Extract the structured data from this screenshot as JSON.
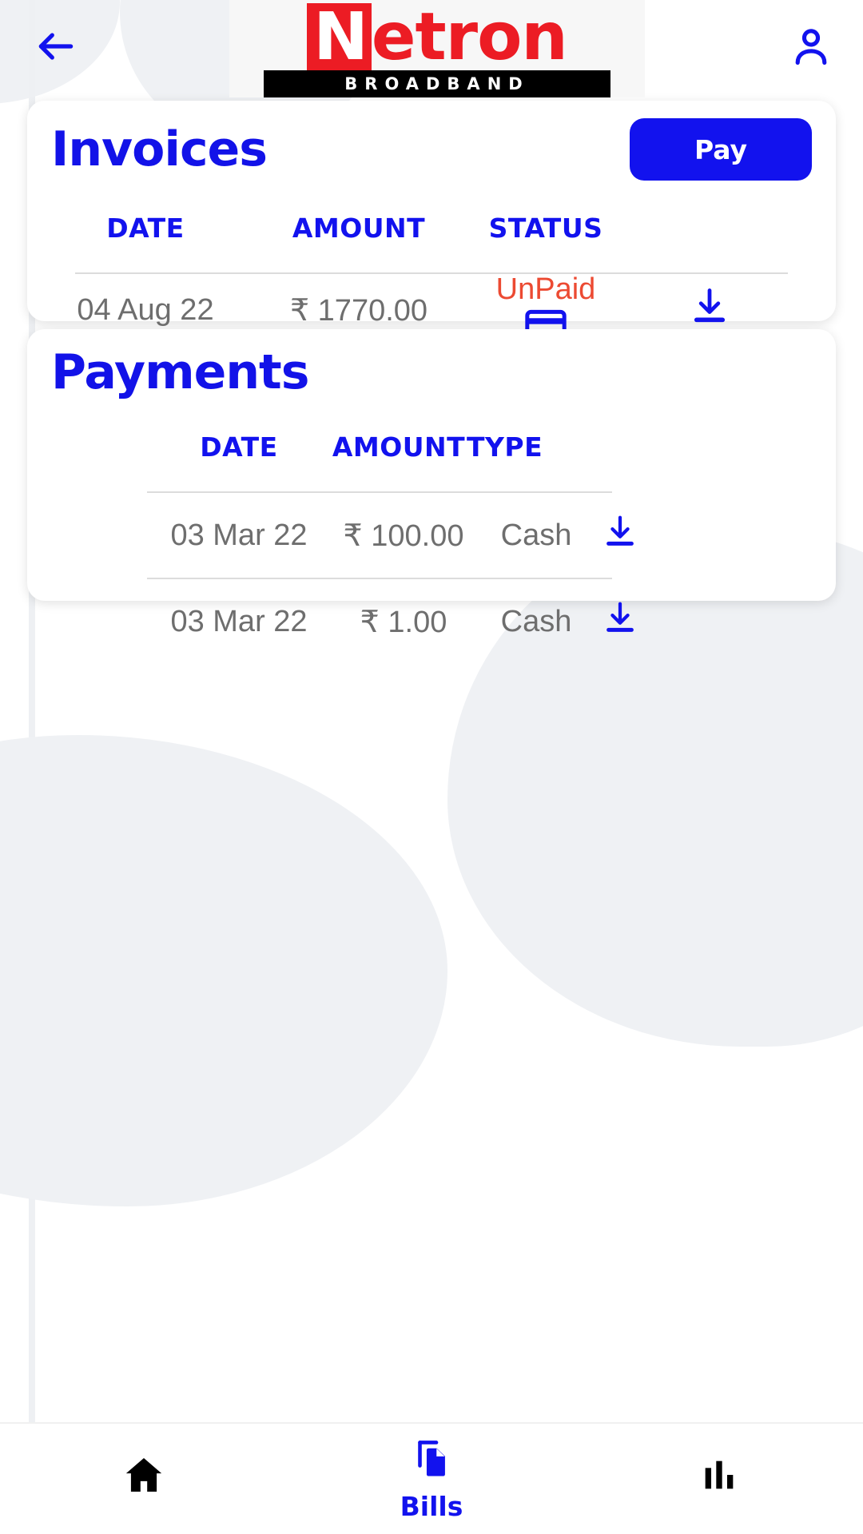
{
  "header": {
    "back_icon": "arrow-left-icon",
    "profile_icon": "person-icon",
    "logo": {
      "initial": "N",
      "rest": "etron",
      "tagline": "BROADBAND"
    }
  },
  "invoices": {
    "title": "Invoices",
    "pay_label": "Pay",
    "columns": [
      "DATE",
      "AMOUNT",
      "STATUS"
    ],
    "rows": [
      {
        "date": "04 Aug 22",
        "amount": "₹ 1770.00",
        "status": "UnPaid",
        "pay_icon": "credit-card-icon",
        "download_icon": "download-icon"
      }
    ]
  },
  "payments": {
    "title": "Payments",
    "columns": [
      "DATE",
      "AMOUNT",
      "TYPE"
    ],
    "rows": [
      {
        "date": "03 Mar 22",
        "amount": "₹ 100.00",
        "type": "Cash",
        "download_icon": "download-icon"
      },
      {
        "date": "03 Mar 22",
        "amount": "₹ 1.00",
        "type": "Cash",
        "download_icon": "download-icon"
      }
    ]
  },
  "bottom_nav": {
    "items": [
      {
        "label": "",
        "icon": "home-icon",
        "active": false
      },
      {
        "label": "Bills",
        "icon": "bills-document-icon",
        "active": true
      },
      {
        "label": "",
        "icon": "bar-chart-icon",
        "active": false
      }
    ]
  },
  "colors": {
    "primary_blue": "#1212ee",
    "logo_red": "#ec1c24",
    "unpaid_red": "#ec4a32",
    "text_grey": "#6e6e6e",
    "blob_grey": "#eff1f4"
  }
}
